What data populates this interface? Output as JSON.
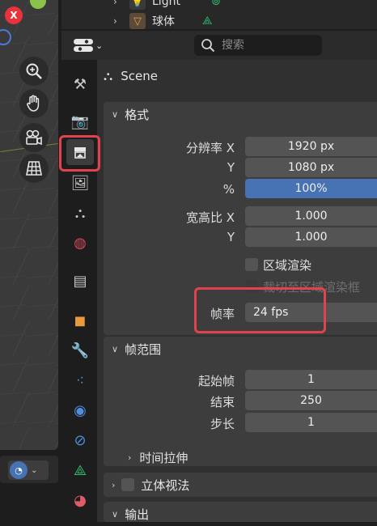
{
  "viewport": {
    "gizmo_x_label": "X"
  },
  "outliner": {
    "items": [
      {
        "label": "Light"
      },
      {
        "label": "球体"
      }
    ]
  },
  "search": {
    "placeholder": "搜索"
  },
  "context": {
    "label": "Scene"
  },
  "format_panel": {
    "title": "格式",
    "resolution_x_label": "分辨率 X",
    "resolution_x": "1920 px",
    "resolution_y_label": "Y",
    "resolution_y": "1080 px",
    "resolution_percent_label": "%",
    "resolution_percent": "100%",
    "aspect_x_label": "宽高比 X",
    "aspect_x": "1.000",
    "aspect_y_label": "Y",
    "aspect_y": "1.000",
    "render_region_label": "区域渲染",
    "crop_region_label": "裁切至区域渲染框",
    "frame_rate_label": "帧率",
    "frame_rate": "24 fps"
  },
  "frame_range_panel": {
    "title": "帧范围",
    "start_label": "起始帧",
    "start": "1",
    "end_label": "结束",
    "end": "250",
    "step_label": "步长",
    "step": "1",
    "time_stretch_label": "时间拉伸"
  },
  "stereoscopy_panel": {
    "title": "立体视法"
  },
  "output_panel": {
    "title": "输出"
  },
  "colors": {
    "accent_blue": "#4772b3",
    "highlight_red": "#e0434c"
  }
}
